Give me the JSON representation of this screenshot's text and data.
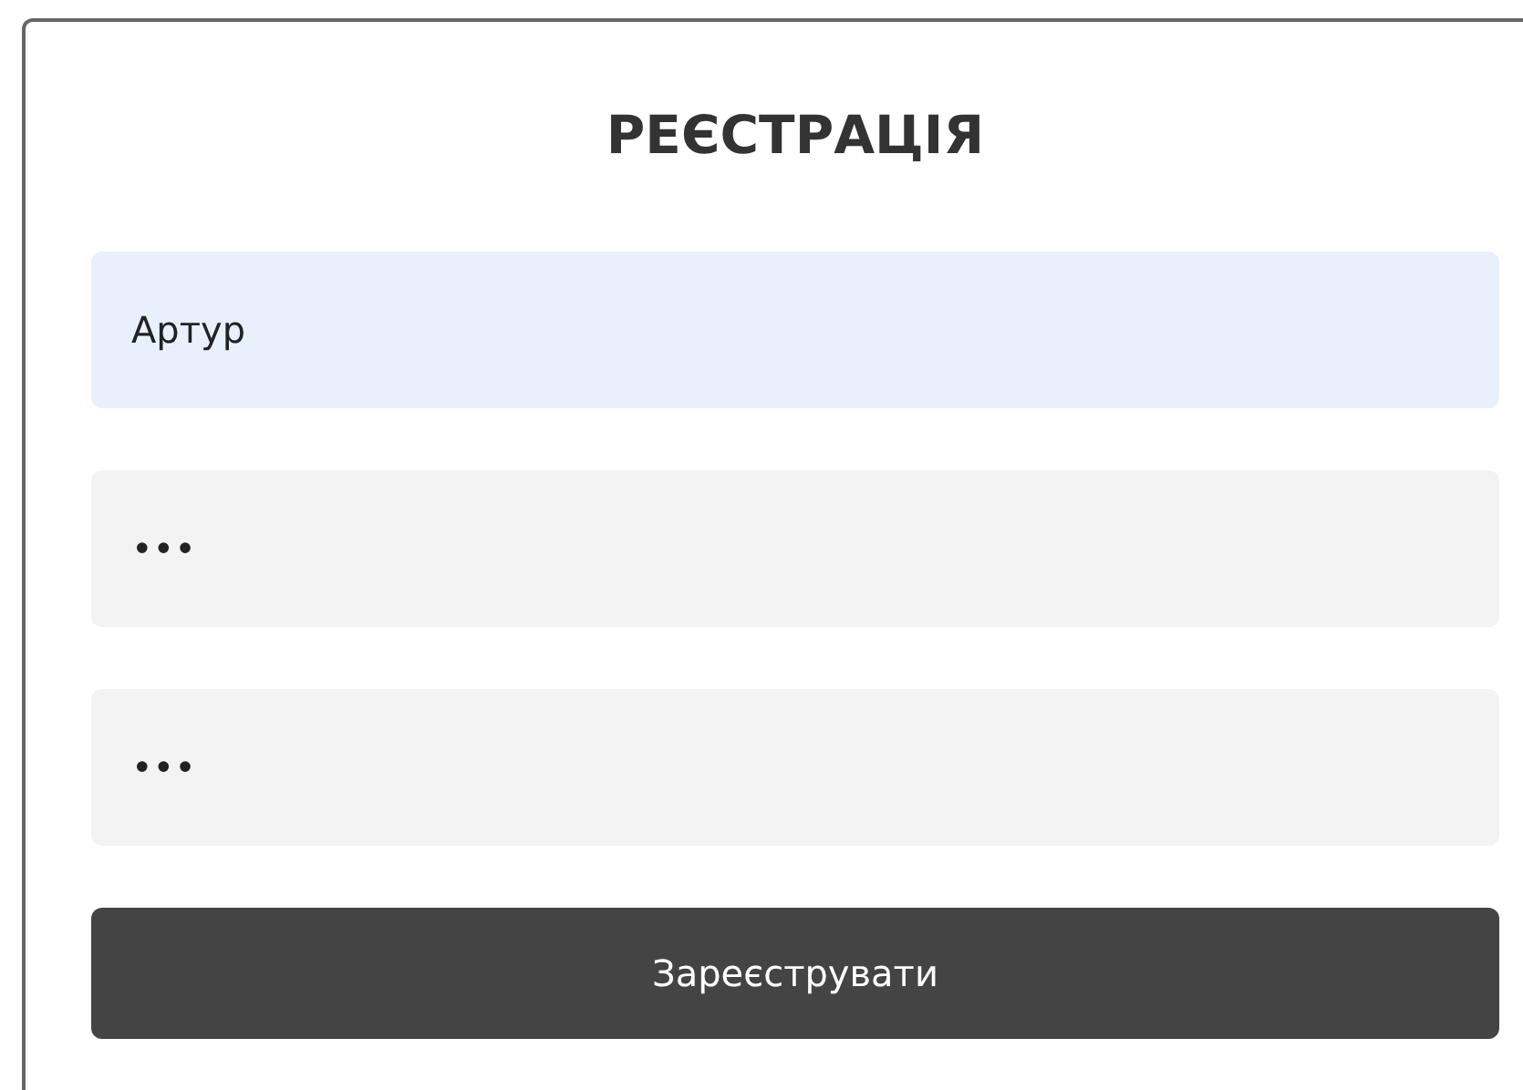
{
  "form": {
    "title": "РЕЄСТРАЦІЯ",
    "fields": [
      {
        "value": "Артур",
        "color": "#e8f0fe"
      },
      {
        "value": "•••",
        "color": "#f3f3f3"
      },
      {
        "value": "•••",
        "color": "#f3f3f3"
      }
    ],
    "submit_button": "Зареєструвати"
  }
}
